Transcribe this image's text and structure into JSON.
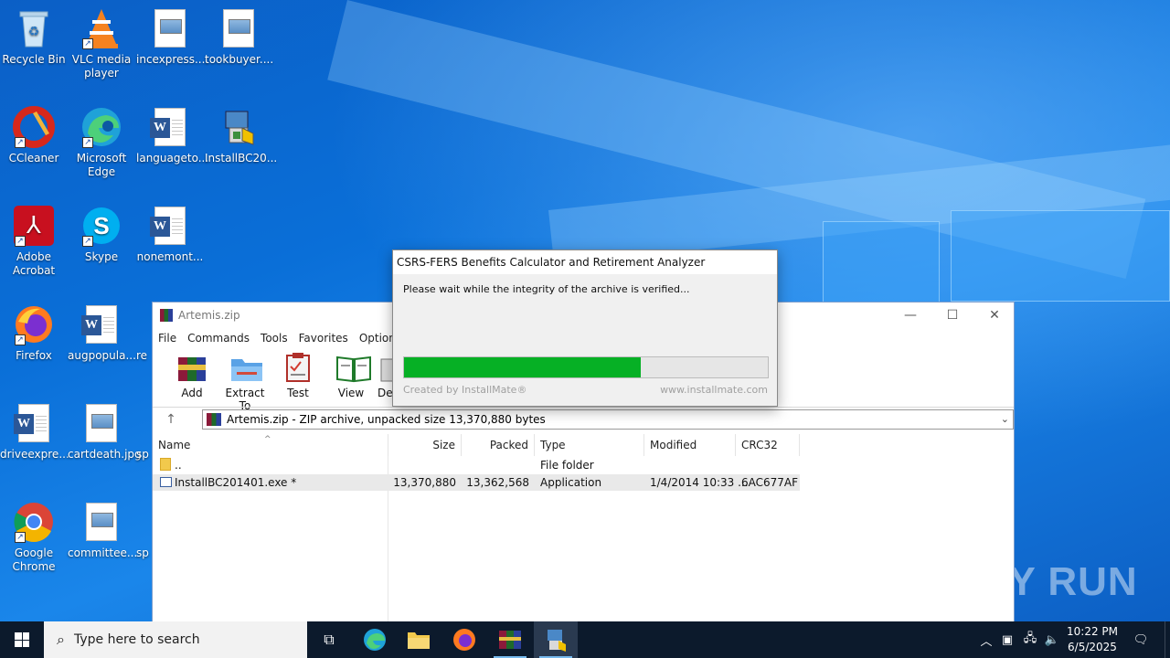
{
  "desktop": {
    "icons": [
      {
        "label": "Recycle Bin",
        "icon": "recycle-bin-icon"
      },
      {
        "label": "VLC media player",
        "icon": "vlc-icon"
      },
      {
        "label": "incexpress....",
        "icon": "image-file-icon"
      },
      {
        "label": "tookbuyer....",
        "icon": "image-file-icon"
      },
      {
        "label": "CCleaner",
        "icon": "ccleaner-icon"
      },
      {
        "label": "Microsoft Edge",
        "icon": "edge-icon"
      },
      {
        "label": "languageto...",
        "icon": "word-doc-icon"
      },
      {
        "label": "InstallBC20...",
        "icon": "installer-icon"
      },
      {
        "label": "Adobe Acrobat",
        "icon": "acrobat-icon"
      },
      {
        "label": "Skype",
        "icon": "skype-icon"
      },
      {
        "label": "nonemont...",
        "icon": "word-doc-icon"
      },
      {
        "label": "Firefox",
        "icon": "firefox-icon"
      },
      {
        "label": "augpopula...",
        "icon": "word-doc-icon"
      },
      {
        "label": "re",
        "icon": "partial-icon"
      },
      {
        "label": "driveexpre...",
        "icon": "word-doc-icon"
      },
      {
        "label": "cartdeath.jpg",
        "icon": "image-file-icon"
      },
      {
        "label": "sp",
        "icon": "partial-icon"
      },
      {
        "label": "Google Chrome",
        "icon": "chrome-icon"
      },
      {
        "label": "committee...",
        "icon": "image-file-icon"
      },
      {
        "label": "sp",
        "icon": "partial-icon"
      }
    ]
  },
  "winrar": {
    "title": "Artemis.zip",
    "menu": [
      "File",
      "Commands",
      "Tools",
      "Favorites",
      "Options"
    ],
    "toolbar": [
      {
        "label": "Add",
        "icon": "add-archive-icon"
      },
      {
        "label": "Extract To",
        "icon": "extract-folder-icon"
      },
      {
        "label": "Test",
        "icon": "test-clipboard-icon"
      },
      {
        "label": "View",
        "icon": "view-book-icon"
      },
      {
        "label": "De",
        "icon": "delete-bin-icon"
      }
    ],
    "address": "Artemis.zip - ZIP archive, unpacked size 13,370,880 bytes",
    "columns": [
      "Name",
      "Size",
      "Packed",
      "Type",
      "Modified",
      "CRC32"
    ],
    "rows": [
      {
        "name": "..",
        "size": "",
        "packed": "",
        "type": "File folder",
        "modified": "",
        "crc": ""
      },
      {
        "name": "InstallBC201401.exe *",
        "size": "13,370,880",
        "packed": "13,362,568",
        "type": "Application",
        "modified": "1/4/2014 10:33 ...",
        "crc": "6AC677AF"
      }
    ]
  },
  "dialog": {
    "title": "CSRS-FERS Benefits Calculator and Retirement Analyzer",
    "message": "Please wait while the integrity of the archive is verified...",
    "progress_fraction": 0.65,
    "credit": "Created by InstallMate®",
    "site": "www.installmate.com"
  },
  "taskbar": {
    "search_placeholder": "Type here to search",
    "time": "10:22 PM",
    "date": "6/5/2025"
  },
  "watermark": "ANY RUN",
  "colors": {
    "progress": "#06b025",
    "taskbar": "#0c1a2c",
    "desktop": "#0a63c9"
  }
}
